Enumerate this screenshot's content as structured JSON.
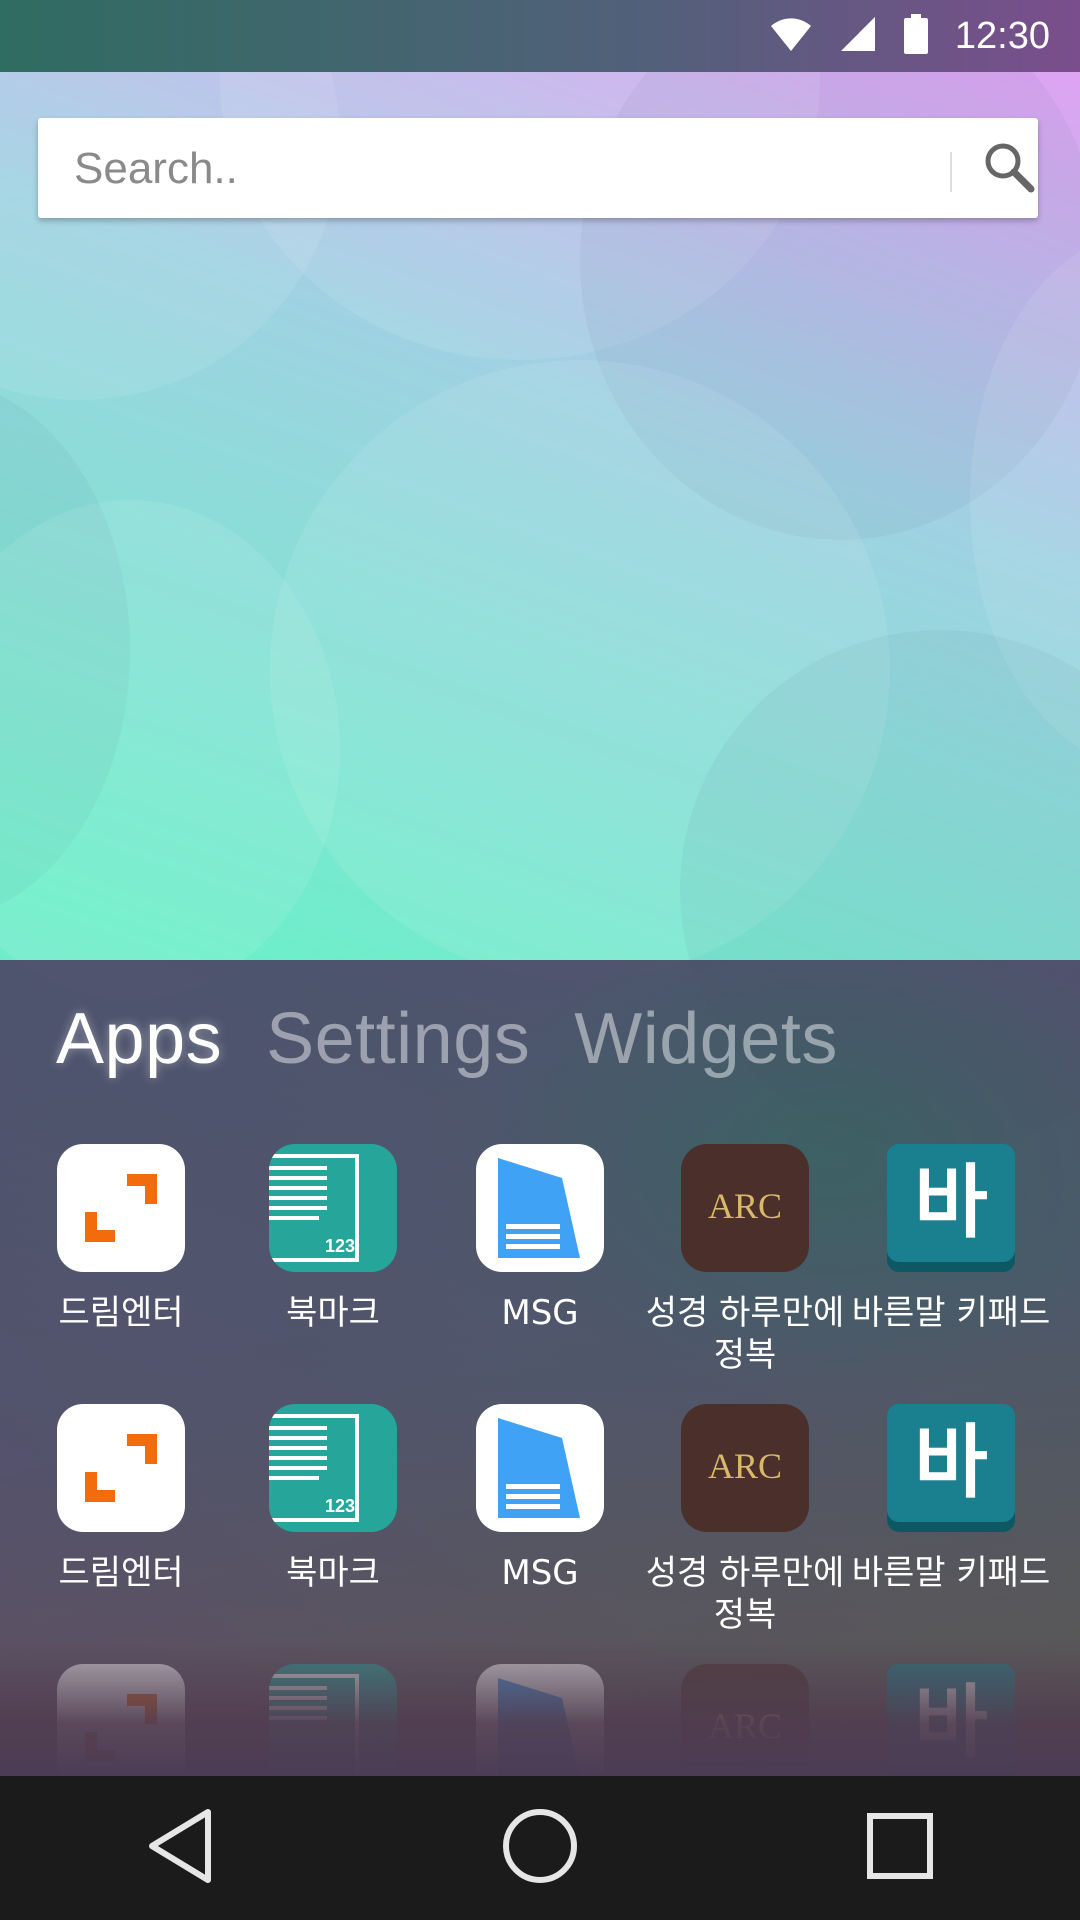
{
  "status_bar": {
    "time": "12:30",
    "icons": [
      "wifi-icon",
      "signal-icon",
      "battery-icon"
    ]
  },
  "search": {
    "placeholder": "Search..",
    "button_icon": "search-icon"
  },
  "drawer": {
    "tabs": [
      {
        "label": "Apps",
        "active": true
      },
      {
        "label": "Settings",
        "active": false
      },
      {
        "label": "Widgets",
        "active": false
      }
    ],
    "apps": [
      {
        "label": "드림엔터",
        "icon": "dreamenter-icon",
        "color": "#ffffff"
      },
      {
        "label": "북마크",
        "icon": "bookmark-icon",
        "color": "#26a69a"
      },
      {
        "label": "MSG",
        "icon": "msg-icon",
        "color": "#ffffff"
      },
      {
        "label": "성경 하루만에 정복",
        "icon": "arc-icon",
        "color": "#4a2f2a",
        "icon_text": "ARC"
      },
      {
        "label": "바른말 키패드",
        "icon": "bareunmal-icon",
        "color": "#1a7f8f",
        "icon_text": "바"
      }
    ]
  },
  "nav_bar": {
    "buttons": [
      "back-icon",
      "home-icon",
      "recents-icon"
    ]
  },
  "colors": {
    "drawer_bg": "#4b3a5a",
    "navbar_bg": "#1b1b1b",
    "accent_orange": "#f26b0c",
    "msg_blue": "#3fa2f5"
  }
}
